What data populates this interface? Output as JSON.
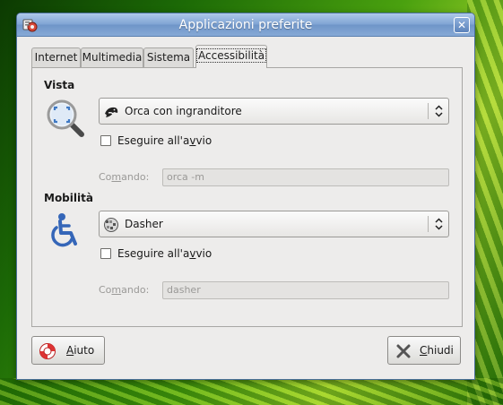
{
  "window": {
    "title": "Applicazioni preferite",
    "close_glyph": "✕"
  },
  "tabs": [
    {
      "label": "Internet",
      "active": false
    },
    {
      "label": "Multimedia",
      "active": false
    },
    {
      "label": "Sistema",
      "active": false
    },
    {
      "label": "Accessibilità",
      "active": true
    }
  ],
  "vista": {
    "title": "Vista",
    "icon": "magnifier-icon",
    "selected": "Orca con ingranditore",
    "selected_icon": "orca-whale-icon",
    "run_at_startup_pre": "Eseguire all'a",
    "run_at_startup_access": "v",
    "run_at_startup_post": "vio",
    "run_at_startup_checked": false,
    "command_label_pre": "Co",
    "command_label_access": "m",
    "command_label_post": "ando:",
    "command_value": "orca -m"
  },
  "mobilita": {
    "title": "Mobilità",
    "icon": "wheelchair-icon",
    "selected": "Dasher",
    "selected_icon": "dasher-icon",
    "run_at_startup_pre": "Eseguire all'a",
    "run_at_startup_access": "v",
    "run_at_startup_post": "vio",
    "run_at_startup_checked": false,
    "command_label_pre": "Co",
    "command_label_access": "m",
    "command_label_post": "ando:",
    "command_value": "dasher"
  },
  "buttons": {
    "help_access": "A",
    "help_rest": "iuto",
    "close_access": "C",
    "close_rest": "hiudi"
  },
  "colors": {
    "titlebar": "#7ea3d3",
    "window_bg": "#edeceb"
  }
}
